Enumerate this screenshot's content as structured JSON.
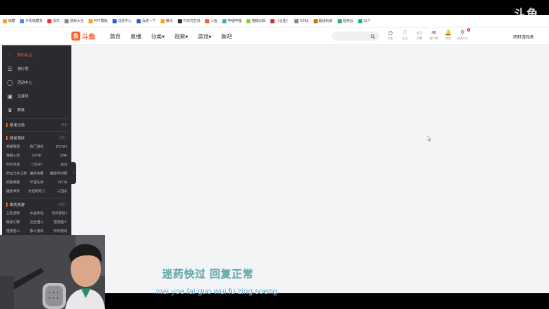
{
  "watermark": "斗鱼",
  "bookmarks": [
    {
      "label": "收藏",
      "color": "#f5a623"
    },
    {
      "label": "手机收藏夹",
      "color": "#4a90e2"
    },
    {
      "label": "京东",
      "color": "#e33"
    },
    {
      "label": "游戏大全",
      "color": "#888"
    },
    {
      "label": "PPT模板",
      "color": "#f5a623"
    },
    {
      "label": "马报中心",
      "color": "#3060c0"
    },
    {
      "label": "百度一下",
      "color": "#3060c0"
    },
    {
      "label": "腾讯",
      "color": "#f5a623"
    },
    {
      "label": "中关村在线",
      "color": "#333"
    },
    {
      "label": "斗鱼",
      "color": "#ff5d23"
    },
    {
      "label": "哔哩哔哩",
      "color": "#4ab"
    },
    {
      "label": "猫眼云库",
      "color": "#8c4"
    },
    {
      "label": "《合金》",
      "color": "#c33"
    },
    {
      "label": "GTA5",
      "color": "#888"
    },
    {
      "label": "超级玩家",
      "color": "#c70"
    },
    {
      "label": "星链云",
      "color": "#3a8"
    },
    {
      "label": "10个",
      "color": "#2b7"
    }
  ],
  "navbar": {
    "logo": "斗鱼",
    "menu": [
      "首页",
      "直播",
      "分类▾",
      "视频▾",
      "游戏▾",
      "鱼吧"
    ],
    "search_placeholder": "",
    "icons": [
      {
        "glyph": "◷",
        "label": "历史",
        "icon": "history-icon"
      },
      {
        "glyph": "♡",
        "label": "关注",
        "icon": "follow-icon"
      },
      {
        "glyph": "▭",
        "label": "开播",
        "icon": "broadcast-icon"
      },
      {
        "glyph": "✉",
        "label": "客户端",
        "icon": "client-icon",
        "badge": "1"
      },
      {
        "glyph": "🔔",
        "label": "消息",
        "icon": "bell-icon"
      },
      {
        "glyph": "⚲",
        "label": "创作中心",
        "icon": "creator-icon"
      }
    ],
    "user": "雨轩游戏君"
  },
  "sidebar": {
    "items": [
      {
        "icon": "♡",
        "label": "我的关注",
        "active": true,
        "name": "heart-icon"
      },
      {
        "icon": "☰",
        "label": "排行榜",
        "active": false,
        "name": "rank-icon"
      },
      {
        "icon": "◯",
        "label": "活动中心",
        "active": false,
        "name": "activity-icon"
      },
      {
        "icon": "▣",
        "label": "云游戏",
        "active": false,
        "name": "cloud-game-icon"
      },
      {
        "icon": "♛",
        "label": "赛事",
        "active": false,
        "name": "trophy-icon"
      }
    ],
    "common_section": {
      "title": "常用分类",
      "more": "更多"
    },
    "online_section": {
      "title": "网游竞技",
      "more": "全部 >",
      "games": [
        "英雄联盟",
        "热门游戏",
        "DOTA2",
        "穿越火线",
        "CFHD",
        "DNF",
        "炉石传说",
        "CSGO",
        "运动",
        "命运方舟之旅",
        "魔兽争霸",
        "魔兽怀旧服",
        "风暴英雄",
        "守望先锋",
        "DOTA",
        "魔兽世界",
        "天涯明月刀",
        "三国杀"
      ]
    },
    "single_section": {
      "title": "单机热游",
      "more": "全部 >",
      "games": [
        "主机游戏",
        "水晶传说",
        "无间冒险2",
        "像素幻想",
        "完全潜入",
        "怪物猎人",
        "怪物猎人",
        "像斗游戏",
        "怀旧游戏"
      ]
    }
  },
  "subtitles": {
    "chinese": "迷药快过 回复正常",
    "pinyin": "mei yoe fai guo wui fu zing soeng"
  }
}
